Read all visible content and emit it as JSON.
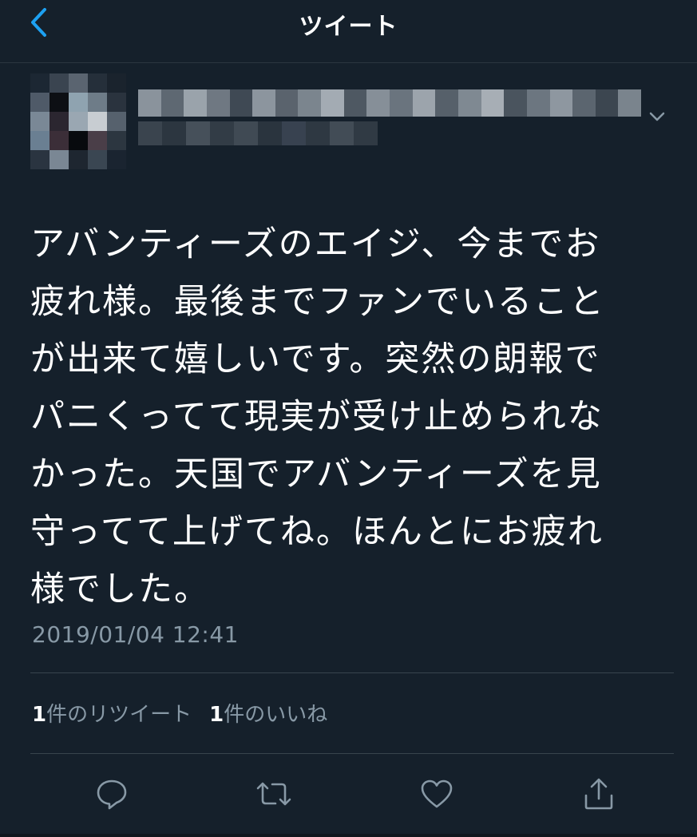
{
  "header": {
    "title": "ツイート",
    "back_icon": "chevron-left-icon"
  },
  "tweet": {
    "text": "アバンティーズのエイジ、今までお\n疲れ様。最後までファンでいること\nが出来て嬉しいです。突然の朗報で\nパニくってて現実が受け止められな\nかった。天国でアバンティーズを見\n守ってて上げてね。ほんとにお疲れ\n様でした。",
    "timestamp": "2019/01/04 12:41",
    "retweet_count": "1",
    "retweet_label": "件のリツイート",
    "like_count": "1",
    "like_label": "件のいいね"
  },
  "actions": [
    "reply-icon",
    "retweet-icon",
    "like-icon",
    "share-icon"
  ],
  "colors": {
    "background": "#15202b",
    "accent": "#1da1f2",
    "muted_text": "#8899a6",
    "divider": "#38444d"
  }
}
